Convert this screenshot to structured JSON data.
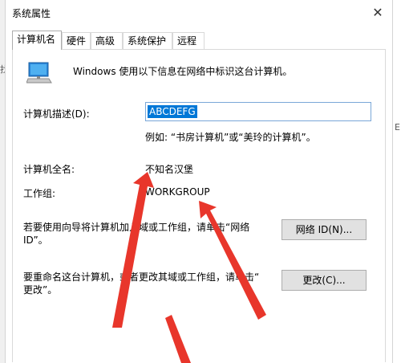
{
  "window": {
    "title": "系统属性",
    "close_symbol": "✕"
  },
  "tabs": [
    "计算机名",
    "硬件",
    "高级",
    "系统保护",
    "远程"
  ],
  "intro": "Windows 使用以下信息在网络中标识这台计算机。",
  "description": {
    "label": "计算机描述(D):",
    "value": "ABCDEFG",
    "example": "例如: “书房计算机”或“美玲的计算机”。"
  },
  "full_name": {
    "label": "计算机全名:",
    "value": "不知名汉堡"
  },
  "workgroup": {
    "label": "工作组:",
    "value": "WORKGROUP"
  },
  "network_id": {
    "text_line1": "若要使用向导将计算机加入域或工作组，请单击“网络",
    "text_line2": "ID”。",
    "button": "网络 ID(N)..."
  },
  "rename": {
    "text_line1": "要重命名这台计算机，或者更改其域或工作组，请单击“",
    "text_line2": "更改”。",
    "button": "更改(C)..."
  },
  "colors": {
    "annotation_arrow": "#e8362b",
    "selection": "#0078d7"
  },
  "icons": {
    "computer": "computer-icon",
    "close": "close-icon"
  }
}
